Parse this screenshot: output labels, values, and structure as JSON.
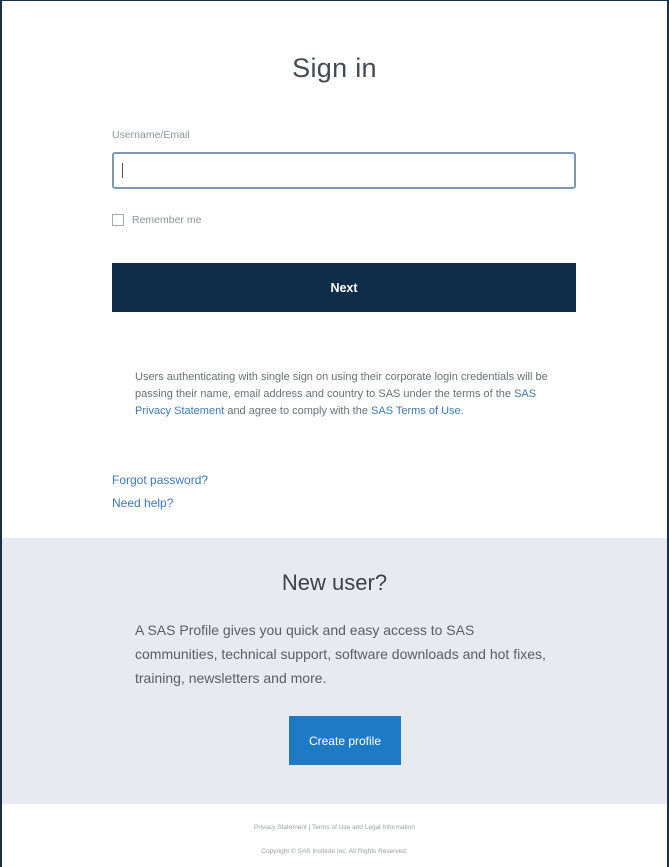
{
  "signin": {
    "title": "Sign in",
    "username_label": "Username/Email",
    "username_value": "",
    "remember_label": "Remember me",
    "next_label": "Next",
    "sso_text_1": "Users authenticating with single sign on using their corporate login credentials will be passing their name, email address and country to SAS under the terms of the ",
    "privacy_link": "SAS Privacy Statement",
    "sso_text_2": " and agree to comply with the ",
    "terms_link": "SAS Terms of Use",
    "sso_text_3": ".",
    "forgot_label": "Forgot password?",
    "help_label": "Need help?"
  },
  "newuser": {
    "title": "New user?",
    "description": "A SAS Profile gives you quick and easy access to SAS communities, technical support, software downloads and hot fixes, training, newsletters and more.",
    "create_label": "Create profile"
  },
  "footer": {
    "privacy_link": "Privacy Statement",
    "separator": " | ",
    "terms_link": "Terms of Use and Legal Information",
    "copyright": "Copyright © SAS Institute Inc. All Rights Reserved."
  },
  "colors": {
    "primary_button": "#0f2c48",
    "secondary_button": "#1f7ac6",
    "link": "#3e78b6",
    "newuser_bg": "#e7eaee"
  }
}
